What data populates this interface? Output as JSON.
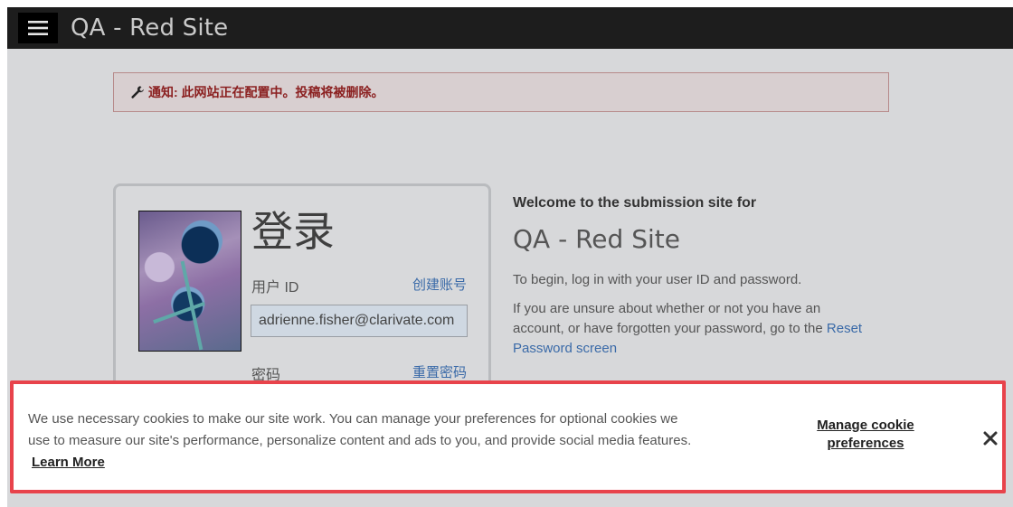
{
  "header": {
    "site_title": "QA - Red Site",
    "menu_icon": "hamburger-menu-icon"
  },
  "notice": {
    "icon": "wrench-icon",
    "text": "通知: 此网站正在配置中。投稿将被删除。"
  },
  "login": {
    "title": "登录",
    "userid_label": "用户 ID",
    "create_account_link": "创建账号",
    "userid_value": "adrienne.fisher@clarivate.com",
    "password_label": "密码",
    "reset_password_link": "重置密码"
  },
  "welcome": {
    "heading": "Welcome to the submission site for",
    "site_name": "QA - Red Site",
    "para1": "To begin, log in with your user ID and password.",
    "para2": "If you are unsure about whether or not you have an account, or have forgotten your password, go to the",
    "reset_link": "Reset Password screen"
  },
  "cookie_banner": {
    "text": "We use necessary cookies to make our site work. You can manage your preferences for optional cookies we use to measure our site's performance, personalize content and ads to you, and provide social media features.",
    "learn_more": "Learn More",
    "manage_prefs": "Manage cookie preferences",
    "close_icon": "close-icon",
    "border_color": "#e8434b"
  },
  "colors": {
    "topbar": "#1d1d1d",
    "notice_text": "#8b2020",
    "link": "#3a6aa8"
  }
}
